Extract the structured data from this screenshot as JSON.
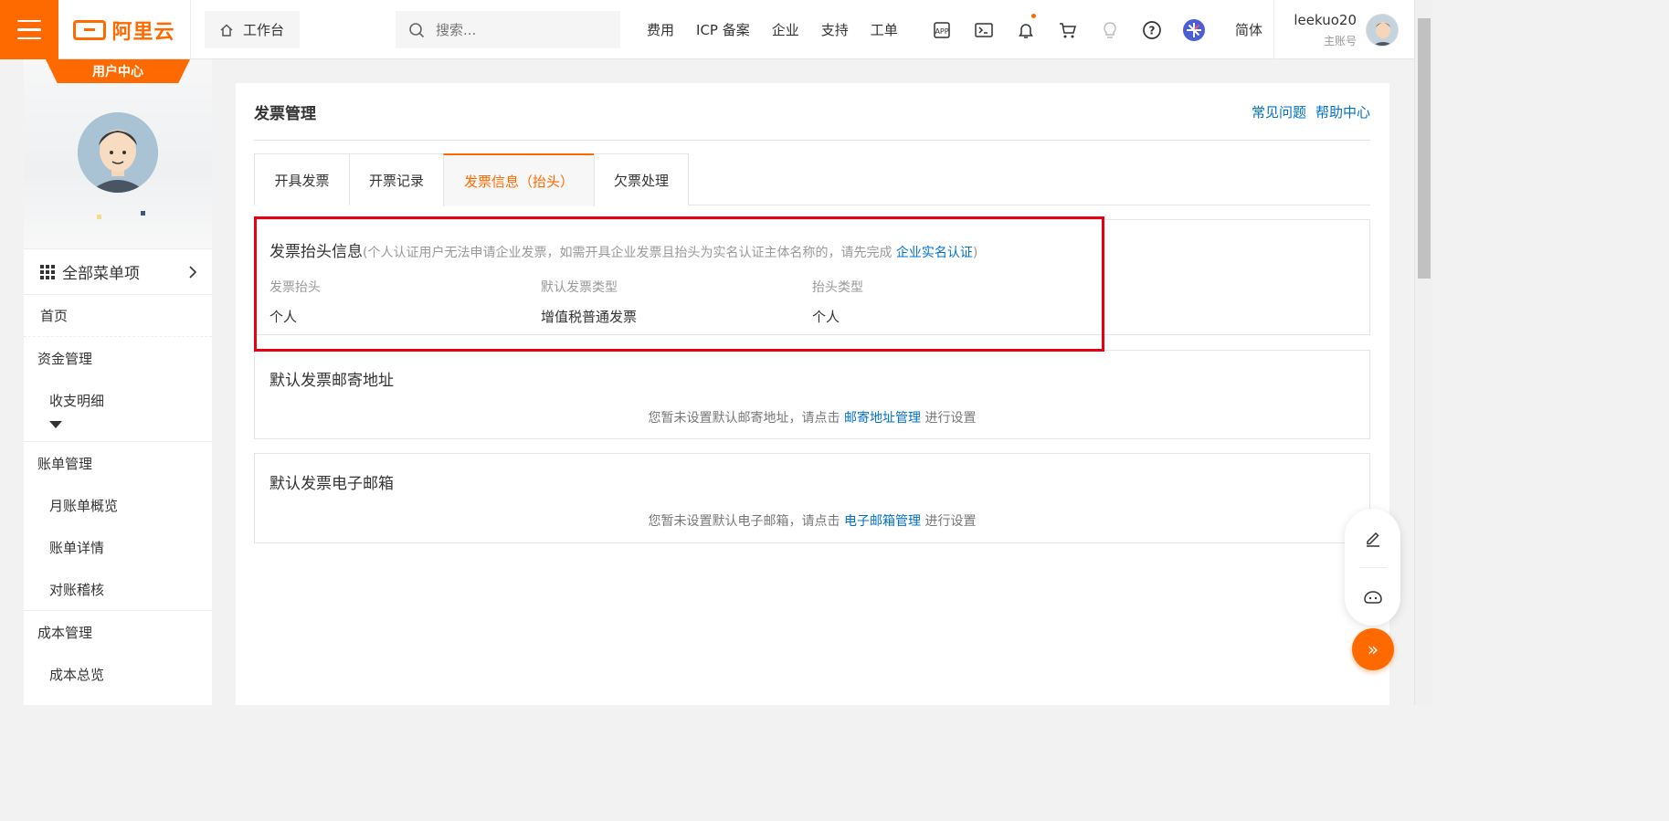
{
  "topbar": {
    "logo_text": "阿里云",
    "workbench_label": "工作台",
    "search_placeholder": "搜索...",
    "nav_links": [
      "费用",
      "ICP 备案",
      "企业",
      "支持",
      "工单"
    ],
    "icons": [
      "app-icon",
      "terminal-icon",
      "bell-icon",
      "cart-icon",
      "lightbulb-icon",
      "help-icon",
      "star-service-icon"
    ],
    "language": "简体",
    "user_name": "leekuo20",
    "user_role": "主账号",
    "accent_color": "#ff6a00"
  },
  "sidebar": {
    "badge": "用户中心",
    "all_menu_label": "全部菜单项",
    "items": [
      {
        "label": "首页",
        "level": 1
      },
      {
        "label": "资金管理",
        "level": 1
      },
      {
        "label": "收支明细",
        "level": 2
      },
      {
        "label": "账单管理",
        "level": 1
      },
      {
        "label": "月账单概览",
        "level": 2
      },
      {
        "label": "账单详情",
        "level": 2
      },
      {
        "label": "对账稽核",
        "level": 2
      },
      {
        "label": "成本管理",
        "level": 1
      },
      {
        "label": "成本总览",
        "level": 2
      }
    ]
  },
  "main": {
    "title": "发票管理",
    "help_links": [
      "常见问题",
      "帮助中心"
    ],
    "tabs": [
      {
        "label": "开具发票",
        "active": false
      },
      {
        "label": "开票记录",
        "active": false
      },
      {
        "label": "发票信息（抬头）",
        "active": true
      },
      {
        "label": "欠票处理",
        "active": false
      }
    ],
    "header_info": {
      "title": "发票抬头信息",
      "note_prefix": "(个人认证用户无法申请企业发票，如需开具企业发票且抬头为实名认证主体名称的，请先完成 ",
      "note_link": "企业实名认证",
      "note_suffix": ")",
      "fields": [
        {
          "label": "发票抬头",
          "value": "个人"
        },
        {
          "label": "默认发票类型",
          "value": "增值税普通发票"
        },
        {
          "label": "抬头类型",
          "value": "个人"
        }
      ]
    },
    "mailing_address": {
      "title": "默认发票邮寄地址",
      "msg_prefix": "您暂未设置默认邮寄地址，请点击 ",
      "msg_link": "邮寄地址管理",
      "msg_suffix": " 进行设置"
    },
    "email": {
      "title": "默认发票电子邮箱",
      "msg_prefix": "您暂未设置默认电子邮箱，请点击 ",
      "msg_link": "电子邮箱管理",
      "msg_suffix": " 进行设置"
    }
  },
  "floating": {
    "icons": [
      "edit-icon",
      "chat-bot-icon",
      "expand-icon"
    ],
    "expand_glyph": "»"
  }
}
